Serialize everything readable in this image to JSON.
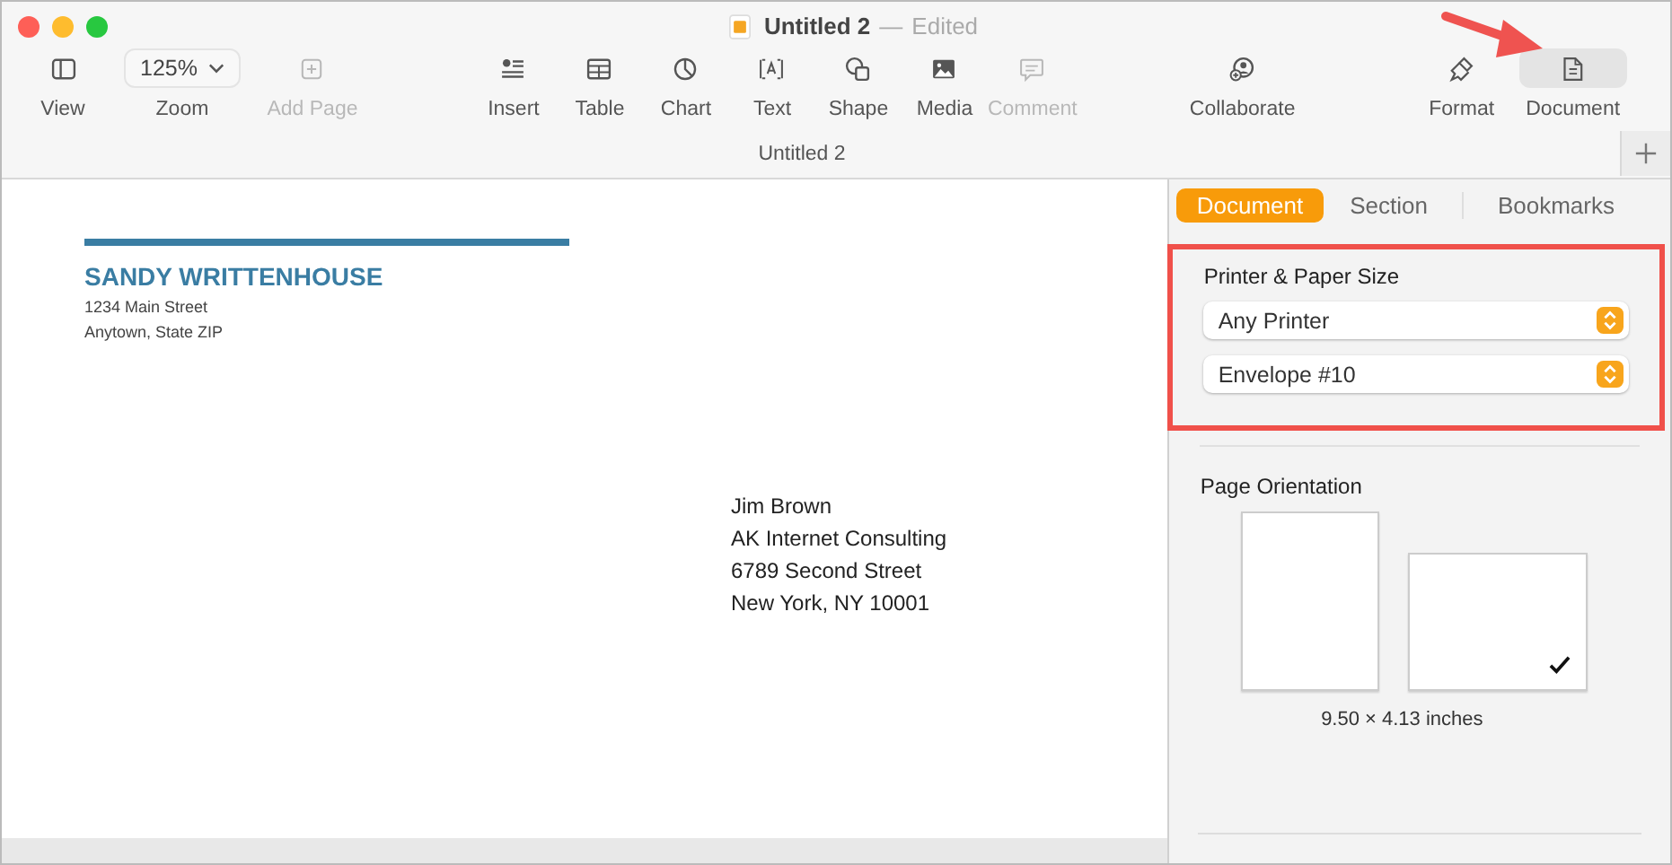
{
  "window": {
    "title": "Untitled 2",
    "separator": "—",
    "status": "Edited"
  },
  "toolbar": {
    "groups": [
      [
        {
          "kind": "icon",
          "label": "View",
          "disabled": false,
          "selected": false
        },
        {
          "kind": "dropdown",
          "label": "Zoom",
          "value": "125%",
          "disabled": false,
          "selected": false
        },
        {
          "kind": "icon",
          "label": "Add Page",
          "disabled": true,
          "selected": false
        }
      ],
      [
        {
          "kind": "icon",
          "label": "Insert",
          "disabled": false,
          "selected": false
        },
        {
          "kind": "icon",
          "label": "Table",
          "disabled": false,
          "selected": false
        },
        {
          "kind": "icon",
          "label": "Chart",
          "disabled": false,
          "selected": false
        },
        {
          "kind": "icon",
          "label": "Text",
          "disabled": false,
          "selected": false
        },
        {
          "kind": "icon",
          "label": "Shape",
          "disabled": false,
          "selected": false
        },
        {
          "kind": "icon",
          "label": "Media",
          "disabled": false,
          "selected": false
        },
        {
          "kind": "icon",
          "label": "Comment",
          "disabled": true,
          "selected": false
        }
      ],
      [
        {
          "kind": "icon",
          "label": "Collaborate",
          "disabled": false,
          "selected": false
        }
      ],
      [
        {
          "kind": "icon",
          "label": "Format",
          "disabled": false,
          "selected": false
        },
        {
          "kind": "icon",
          "label": "Document",
          "disabled": false,
          "selected": true
        }
      ]
    ]
  },
  "tab_title": "Untitled 2",
  "document": {
    "sender": {
      "name": "SANDY WRITTENHOUSE",
      "lines": [
        "1234 Main Street",
        "Anytown, State ZIP"
      ]
    },
    "recipient": [
      "Jim Brown",
      "AK Internet Consulting",
      "6789 Second Street",
      "New York, NY 10001"
    ]
  },
  "sidebar": {
    "tabs": [
      {
        "label": "Document",
        "selected": true
      },
      {
        "label": "Section",
        "selected": false
      },
      {
        "label": "Bookmarks",
        "selected": false
      }
    ],
    "printer_section": {
      "title": "Printer & Paper Size",
      "highlighted": true,
      "popups": [
        "Any Printer",
        "Envelope #10"
      ]
    },
    "orientation": {
      "title": "Page Orientation",
      "options": [
        {
          "kind": "portrait",
          "selected": false
        },
        {
          "kind": "landscape",
          "selected": true
        }
      ],
      "size": "9.50 × 4.13 inches"
    }
  },
  "annotation_arrow": true
}
